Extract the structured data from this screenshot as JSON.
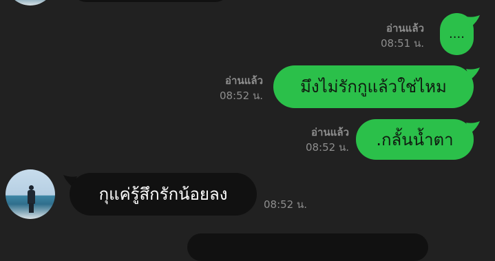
{
  "colors": {
    "background": "#212121",
    "sent_bubble": "#2bc04a",
    "received_bubble": "#111111",
    "meta_text": "#8e8e8e"
  },
  "messages": [
    {
      "direction": "sent",
      "text": "....",
      "read_label": "อ่านแล้ว",
      "time": "08:51 น."
    },
    {
      "direction": "sent",
      "text": "มึงไม่รักกูแล้วใช่ไหม",
      "read_label": "อ่านแล้ว",
      "time": "08:52 น."
    },
    {
      "direction": "sent",
      "text": ".กลั้นน้ำตา",
      "read_label": "อ่านแล้ว",
      "time": "08:52 น."
    },
    {
      "direction": "received",
      "text": "กุแค่รู้สึกรักน้อยลง",
      "time": "08:52 น."
    }
  ]
}
